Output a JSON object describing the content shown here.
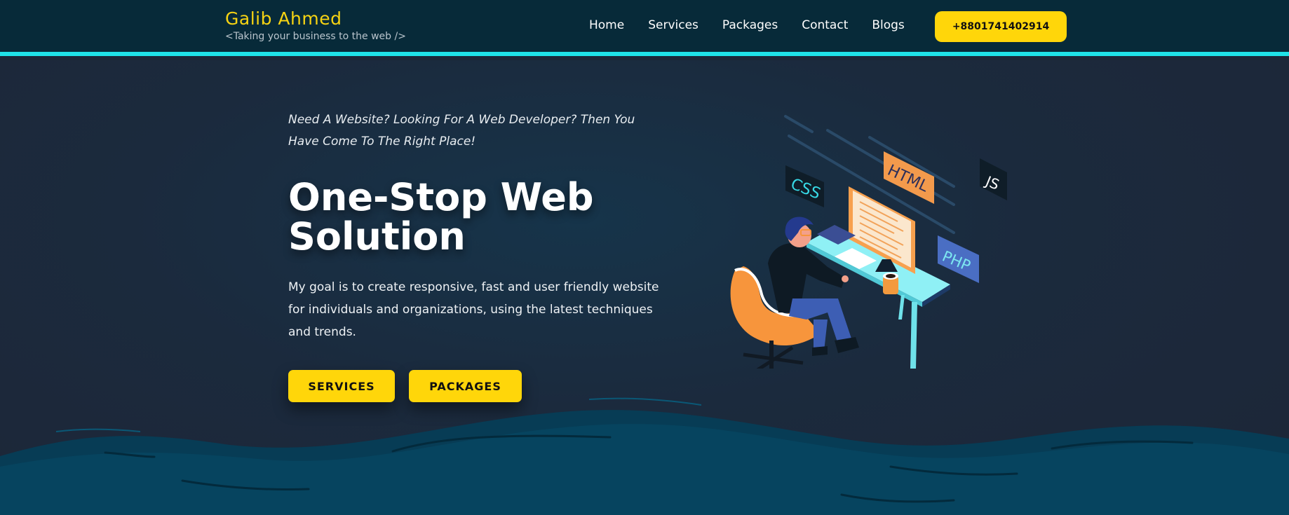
{
  "header": {
    "brand_name": "Galib Ahmed",
    "brand_tagline": "<Taking your business to the web />",
    "nav": [
      {
        "label": "Home"
      },
      {
        "label": "Services"
      },
      {
        "label": "Packages"
      },
      {
        "label": "Contact"
      },
      {
        "label": "Blogs"
      }
    ],
    "phone_label": "+8801741402914"
  },
  "hero": {
    "tagline": "Need A Website? Looking For A Web Developer? Then You Have Come To The Right Place!",
    "headline": "One-Stop Web Solution",
    "description": "My goal is to create responsive, fast and user friendly website for individuals and organizations, using the latest techniques and trends.",
    "buttons": {
      "services": "SERVICES",
      "packages": "PACKAGES"
    }
  },
  "illustration": {
    "tags": {
      "css": "CSS",
      "html": "HTML",
      "js": "JS",
      "php": "PHP"
    }
  },
  "colors": {
    "accent_yellow": "#ffd60a",
    "brand_yellow": "#f6d313",
    "header_bg": "#072a39",
    "header_border": "#1fe3e8",
    "hero_bg": "#1b2a3d",
    "wave": "#06445f"
  }
}
